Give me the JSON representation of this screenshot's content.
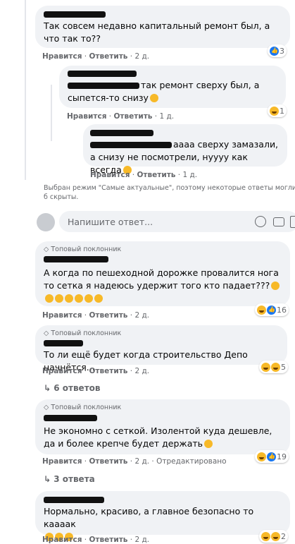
{
  "comments": [
    {
      "text": "Так совсем недавно капитальный ремонт был, а что так то??",
      "actions": {
        "like": "Нравится",
        "reply": "Ответить",
        "time": "2 д."
      },
      "reaction_count": "3"
    },
    {
      "text": "так ремонт сверху был, а сыпется-то снизу",
      "actions": {
        "like": "Нравится",
        "reply": "Ответить",
        "time": "1 д."
      },
      "reaction_count": "1"
    },
    {
      "text": "аааа сверху замазали, а снизу не посмотрели, нуууу как всегда",
      "actions": {
        "like": "Нравится",
        "reply": "Ответить",
        "time": "1 д."
      }
    },
    {
      "badge": "Топовый поклонник",
      "text": "А когда по пешеходной дорожке провалится нога то сетка я надеюсь удержит того кто падает???",
      "actions": {
        "like": "Нравится",
        "reply": "Ответить",
        "time": "2 д."
      },
      "reaction_count": "16"
    },
    {
      "badge": "Топовый поклонник",
      "text": "То ли ещё будет когда строительство Депо начнётся...",
      "actions": {
        "like": "Нравится",
        "reply": "Ответить",
        "time": "2 д."
      },
      "reaction_count": "5",
      "replies": "6 ответов"
    },
    {
      "badge": "Топовый поклонник",
      "text": "Не экономно с сеткой. Изолентой куда дешевле, да и более крепче будет держать",
      "actions": {
        "like": "Нравится",
        "reply": "Ответить",
        "time": "2 д.",
        "edited": "Отредактировано"
      },
      "reaction_count": "19",
      "replies": "3 ответа"
    },
    {
      "text": "Нормально, красиво, а главное безопасно то кааaак",
      "actions": {
        "like": "Нравится",
        "reply": "Ответить",
        "time": "2 д."
      },
      "reaction_count": "2"
    }
  ],
  "notice": "Выбран режим \"Самые актуальные\", поэтому некоторые ответы могли б скрыты.",
  "reply_box": {
    "placeholder": "Напишите ответ..."
  },
  "sep": " · "
}
